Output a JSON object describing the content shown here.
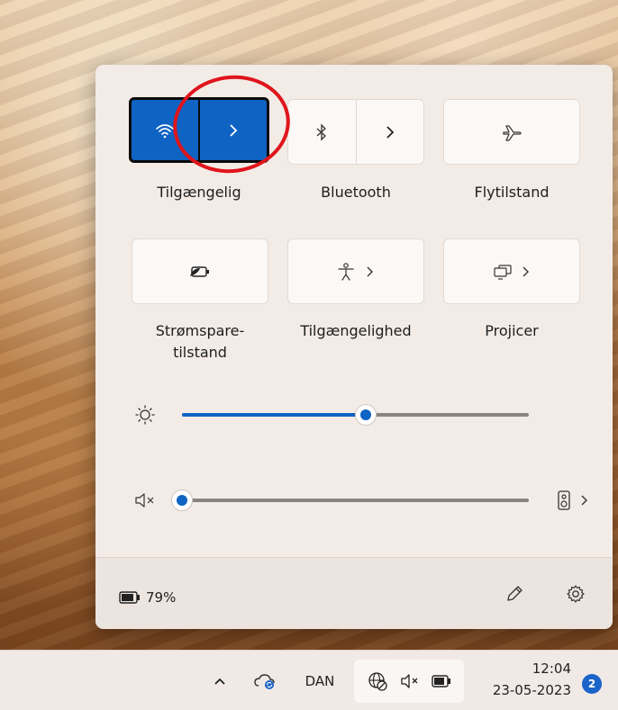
{
  "quick_settings": {
    "tiles_row1": [
      {
        "label": "Tilgængelig",
        "icon": "wifi-icon",
        "state": "on",
        "has_expand": true
      },
      {
        "label": "Bluetooth",
        "icon": "bluetooth-icon",
        "state": "off",
        "has_expand": true
      },
      {
        "label": "Flytilstand",
        "icon": "airplane-icon",
        "state": "off",
        "has_expand": false
      }
    ],
    "tiles_row2": [
      {
        "label_line1": "Strømspare-",
        "label_line2": "tilstand",
        "icon": "battery-saver-icon",
        "state": "off"
      },
      {
        "label": "Tilgængelighed",
        "icon": "accessibility-icon",
        "state": "off",
        "has_expand": true
      },
      {
        "label": "Projicer",
        "icon": "project-icon",
        "state": "off",
        "has_expand": true
      }
    ],
    "brightness": {
      "icon": "brightness-icon",
      "level": 0.53
    },
    "volume": {
      "icon": "speaker-muted-icon",
      "level": 0.0,
      "output_icon": "speaker-device-icon"
    },
    "battery_percent": "79%",
    "footer_icons": [
      "edit-pencil-icon",
      "settings-gear-icon"
    ]
  },
  "taskbar": {
    "language": "DAN",
    "time": "12:04",
    "date": "23-05-2023",
    "notification_count": "2",
    "tray_icons": [
      "chevron-up-icon",
      "onedrive-sync-icon",
      "no-internet-globe-icon",
      "speaker-muted-icon",
      "battery-icon"
    ]
  },
  "colors": {
    "accent": "#0f63c3",
    "annotation": "#e0141b",
    "flyout_bg": "#f2ebe6"
  }
}
